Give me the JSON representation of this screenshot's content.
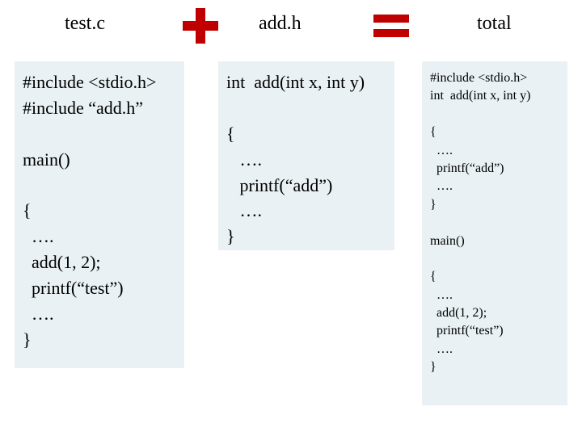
{
  "headers": {
    "test": "test.c",
    "add": "add.h",
    "total": "total"
  },
  "code": {
    "test": "#include <stdio.h>\n#include “add.h”\n\nmain()\n\n{\n  ….\n  add(1, 2);\n  printf(“test”)\n  ….\n}",
    "add": "int  add(int x, int y)\n\n{\n   ….\n   printf(“add”)\n   ….\n}",
    "total": "#include <stdio.h>\nint  add(int x, int y)\n\n{\n  ….\n  printf(“add”)\n  ….\n}\n\nmain()\n\n{\n  ….\n  add(1, 2);\n  printf(“test”)\n  ….\n}"
  }
}
